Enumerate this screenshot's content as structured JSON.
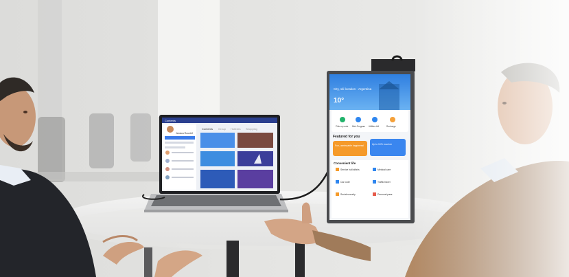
{
  "laptop_screen": {
    "profile_name": "Jessica Rountrif",
    "tabs": [
      "Contents",
      "Group",
      "Hobbies",
      "Shopping"
    ]
  },
  "portable_monitor": {
    "location": "City, ski location · Argentina",
    "temperature": "10°",
    "shortcuts": [
      "Pick-up code",
      "Mini-Program",
      "Utilities bill",
      "Recharge"
    ],
    "featured_title": "Featured for you",
    "featured_cards": [
      "Fun, unmissable happiness!",
      "Up to 10% voucher"
    ],
    "convenient_title": "Convenient life",
    "services": [
      "Service hall affairs",
      "Medical care",
      "Car code",
      "Traffic travel",
      "Social security",
      "Personal pass"
    ]
  },
  "colors": {
    "monitor_header": "#3f8fe6",
    "card_orange": "#f59a2a",
    "card_blue": "#3a86ef",
    "suit_dark": "#23252a",
    "jacket_tan": "#a07b5a"
  }
}
